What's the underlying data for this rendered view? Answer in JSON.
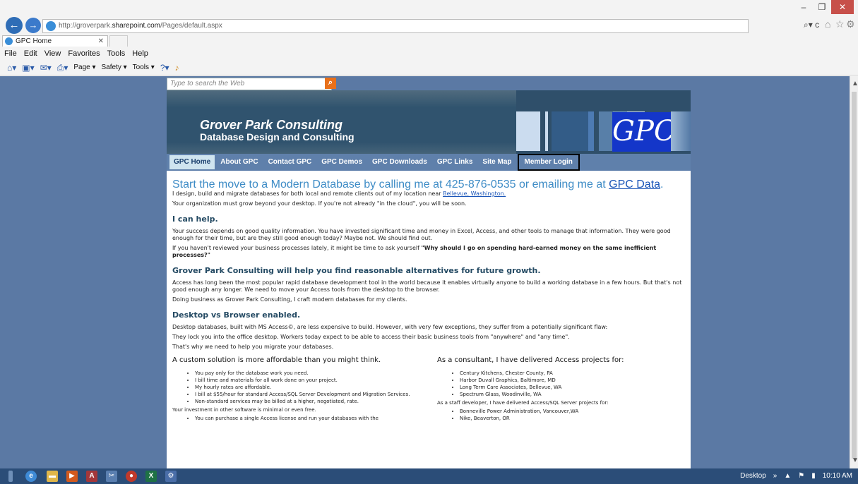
{
  "browser": {
    "url_prefix": "http://groverpark.",
    "url_host": "sharepoint.com",
    "url_suffix": "/Pages/default.aspx",
    "tab_title": "GPC Home",
    "search_glyph": "⌕▾ c",
    "menu": [
      "File",
      "Edit",
      "View",
      "Favorites",
      "Tools",
      "Help"
    ],
    "commands": [
      "Page ▾",
      "Safety ▾",
      "Tools ▾"
    ]
  },
  "page": {
    "search_placeholder": "Type to search the Web",
    "header_title": "Grover Park Consulting",
    "header_subtitle": "Database Design and Consulting",
    "logo_text": "GPC",
    "nav": [
      {
        "label": "GPC Home",
        "active": true
      },
      {
        "label": "About GPC"
      },
      {
        "label": "Contact GPC"
      },
      {
        "label": "GPC Demos"
      },
      {
        "label": "GPC Downloads"
      },
      {
        "label": "GPC Links"
      },
      {
        "label": "Site Map"
      },
      {
        "label": "Member Login"
      }
    ],
    "headline": "Start the move to a Modern Database by calling me at 425-876-0535 or emailing me at",
    "headline_link": "GPC Data",
    "intro1": "I design, build and migrate databases for both local and remote clients out of my location near",
    "intro1_link": "Bellevue, Washington.",
    "intro2": "Your organization must grow beyond your desktop. If you're not already \"in the cloud\", you will be soon.",
    "h_help": "I can help.",
    "help1": "Your success depends on good quality information. You have invested significant time and money in Excel, Access, and other tools to manage that information. They were good enough for their time, but are they still good enough today? Maybe not. We should find out.",
    "help2_pre": "If you haven't reviewed your business processes lately, it might be time to ask yourself ",
    "help2_bold": "\"Why should I go on spending hard-earned money on the same inefficient processes?\"",
    "h_growth": "Grover Park Consulting will help you find reasonable alternatives for future growth.",
    "growth1": "Access has long been the most popular rapid database development tool in the world because it enables virtually anyone to build a working database in a few hours. But that's not good enough any longer. We need to move your Access tools from the desktop to the browser.",
    "growth2": "Doing business as Grover Park Consulting, I craft modern databases for my clients.",
    "h_desktop": "Desktop vs Browser enabled.",
    "desk1": "Desktop databases, built with MS Access©, are less expensive to build. However, with very few exceptions, they suffer from a potentially significant flaw:",
    "desk2": "They lock you into the office desktop. Workers today expect to be able to access their basic business tools from \"anywhere\" and \"any time\".",
    "desk3": "That's why we need to help you migrate your databases.",
    "left_title": "A custom solution is more affordable than you might think.",
    "left_items": [
      "You pay only for the database work you need.",
      "I bill time and materials for all work done on your project.",
      "My hourly rates are affordable.",
      "I bill at $55/hour for standard Access/SQL Server Development and Migration Services.",
      "Non-standard services may be billed at a higher, negotiated, rate."
    ],
    "left_note": "Your investment in other software is minimal or even free.",
    "left_item_last": "You can purchase a single Access license and run your databases with the",
    "right_title": "As a consultant, I have delivered Access projects for:",
    "right_items": [
      "Century Kitchens, Chester County, PA",
      "Harbor Duvall Graphics, Baltimore, MD",
      "Long Term Care Associates, Bellevue, WA",
      "Spectrum Glass, Woodinville, WA"
    ],
    "right_note": "As a staff developer, I have delivered Access/SQL Server projects for:",
    "right_items2": [
      "Bonneville Power Administration, Vancouver,WA",
      "Nike, Beaverton, OR"
    ]
  },
  "taskbar": {
    "desktop_label": "Desktop",
    "time": "10:10 AM"
  }
}
